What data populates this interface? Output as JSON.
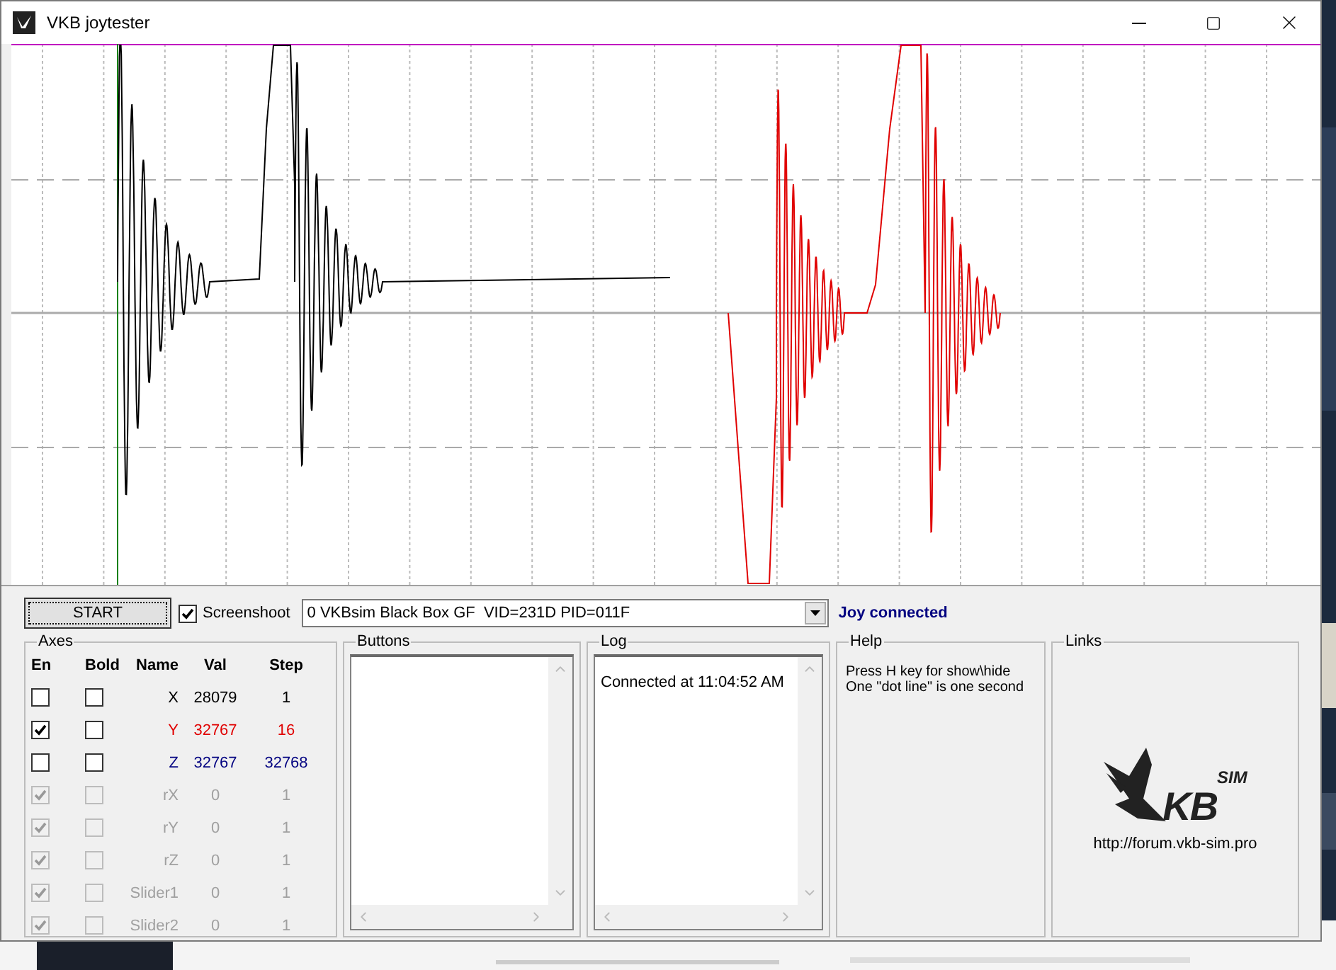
{
  "window": {
    "title": "VKB joytester"
  },
  "toolbar": {
    "start_button": "START",
    "screenshoot": {
      "label": "Screenshoot",
      "checked": true
    },
    "device_select": {
      "value": "0 VKBsim Black Box GF  VID=231D PID=011F"
    },
    "status": "Joy connected"
  },
  "axes": {
    "title": "Axes",
    "columns": [
      "En",
      "Bold",
      "Name",
      "Val",
      "Step"
    ],
    "rows": [
      {
        "name": "X",
        "val": "28079",
        "step": "1",
        "enabled": false,
        "bold": false,
        "disabled": false,
        "color": "#000000"
      },
      {
        "name": "Y",
        "val": "32767",
        "step": "16",
        "enabled": true,
        "bold": false,
        "disabled": false,
        "color": "#e00000"
      },
      {
        "name": "Z",
        "val": "32767",
        "step": "32768",
        "enabled": false,
        "bold": false,
        "disabled": false,
        "color": "#000080"
      },
      {
        "name": "rX",
        "val": "0",
        "step": "1",
        "enabled": true,
        "bold": false,
        "disabled": true
      },
      {
        "name": "rY",
        "val": "0",
        "step": "1",
        "enabled": true,
        "bold": false,
        "disabled": true
      },
      {
        "name": "rZ",
        "val": "0",
        "step": "1",
        "enabled": true,
        "bold": false,
        "disabled": true
      },
      {
        "name": "Slider1",
        "val": "0",
        "step": "1",
        "enabled": true,
        "bold": false,
        "disabled": true
      },
      {
        "name": "Slider2",
        "val": "0",
        "step": "1",
        "enabled": true,
        "bold": false,
        "disabled": true
      }
    ]
  },
  "buttons_panel": {
    "title": "Buttons"
  },
  "log": {
    "title": "Log",
    "lines": [
      "Connected at 11:04:52 AM"
    ]
  },
  "help": {
    "title": "Help",
    "lines": [
      "Press H key for show\\hide",
      "One \"dot line\" is one second"
    ]
  },
  "links": {
    "title": "Links",
    "logo": {
      "text": "KB",
      "superscript": "SIM"
    },
    "url": "http://forum.vkb-sim.pro"
  }
}
